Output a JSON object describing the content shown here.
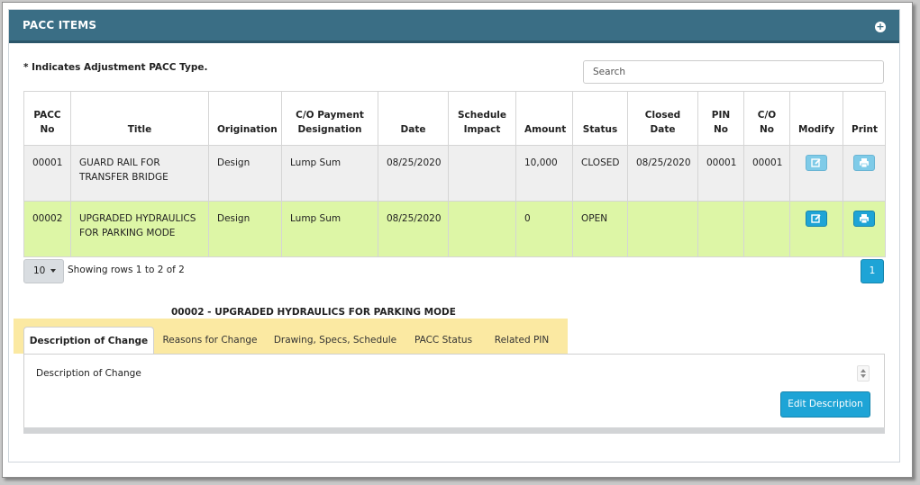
{
  "panel": {
    "title": "PACC ITEMS",
    "expand_icon": "plus-circle-icon"
  },
  "note": "* Indicates Adjustment PACC Type.",
  "search": {
    "placeholder": "Search"
  },
  "table": {
    "headers": [
      "PACC No",
      "Title",
      "Origination",
      "C/O Payment Designation",
      "Date",
      "Schedule Impact",
      "Amount",
      "Status",
      "Closed Date",
      "PIN No",
      "C/O No",
      "Modify",
      "Print"
    ],
    "header_lines": [
      [
        "PACC",
        "No"
      ],
      [
        "Title"
      ],
      [
        "Origination"
      ],
      [
        "C/O Payment",
        "Designation"
      ],
      [
        "Date"
      ],
      [
        "Schedule",
        "Impact"
      ],
      [
        "Amount"
      ],
      [
        "Status"
      ],
      [
        "Closed",
        "Date"
      ],
      [
        "PIN",
        "No"
      ],
      [
        "C/O",
        "No"
      ],
      [
        "Modify"
      ],
      [
        "Print"
      ]
    ],
    "rows": [
      {
        "pacc_no": "00001",
        "title_lines": [
          "GUARD RAIL FOR",
          "TRANSFER BRIDGE"
        ],
        "origination": "Design",
        "payment": "Lump Sum",
        "date": "08/25/2020",
        "schedule_impact": "",
        "amount": "10,000",
        "status": "CLOSED",
        "closed_date": "08/25/2020",
        "pin_no": "00001",
        "co_no": "00001",
        "modify_icon": "edit-icon",
        "print_icon": "printer-icon",
        "highlight": "#efefef"
      },
      {
        "pacc_no": "00002",
        "title_lines": [
          "UPGRADED HYDRAULICS",
          "FOR PARKING MODE"
        ],
        "origination": "Design",
        "payment": "Lump Sum",
        "date": "08/25/2020",
        "schedule_impact": "",
        "amount": "0",
        "status": "OPEN",
        "closed_date": "",
        "pin_no": "",
        "co_no": "",
        "modify_icon": "edit-icon",
        "print_icon": "printer-icon",
        "highlight": "#ddf6a6"
      }
    ]
  },
  "pager": {
    "page_size": "10",
    "info": "Showing rows 1 to 2 of 2",
    "current_page": "1"
  },
  "detail": {
    "title": "00002 - UPGRADED HYDRAULICS FOR PARKING MODE",
    "tabs": [
      "Description of Change",
      "Reasons for Change",
      "Drawing, Specs, Schedule",
      "PACC Status",
      "Related PIN"
    ],
    "active_tab": "Description of Change",
    "content_label": "Description of Change",
    "edit_button": "Edit Description"
  },
  "colors": {
    "header_bg": "#3a6e85",
    "accent_blue": "#1ea4d6",
    "selected_row": "#ddf6a6",
    "tab_highlight": "#fbe9a2"
  }
}
